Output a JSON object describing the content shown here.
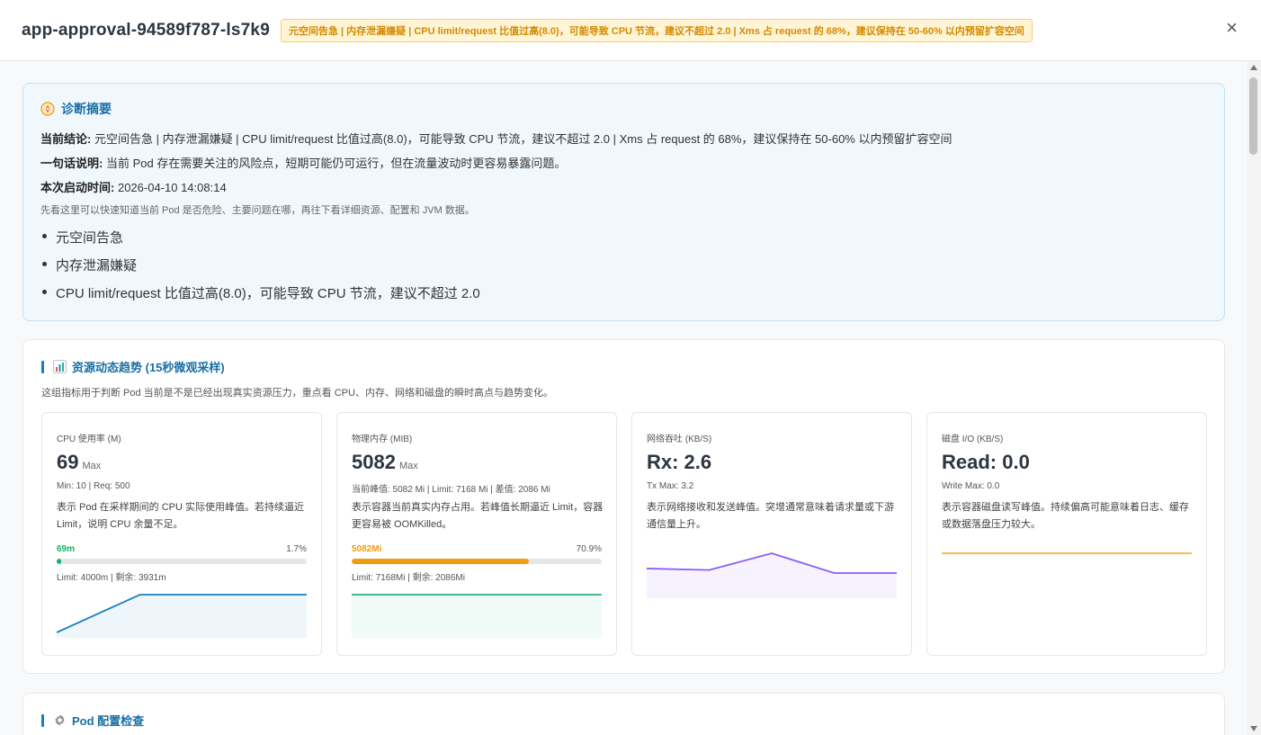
{
  "header": {
    "pod_name": "app-approval-94589f787-ls7k9",
    "alert_badge": "元空间告急 | 内存泄漏嫌疑 | CPU limit/request 比值过高(8.0)，可能导致 CPU 节流，建议不超过 2.0 | Xms 占 request 的 68%，建议保持在 50-60% 以内预留扩容空间",
    "close_label": "×"
  },
  "summary": {
    "title": "诊断摘要",
    "conclusion_label": "当前结论:",
    "conclusion": "元空间告急 | 内存泄漏嫌疑 | CPU limit/request 比值过高(8.0)，可能导致 CPU 节流，建议不超过 2.0 | Xms 占 request 的 68%，建议保持在 50-60% 以内预留扩容空间",
    "explain_label": "一句话说明:",
    "explain": "当前 Pod 存在需要关注的风险点，短期可能仍可运行，但在流量波动时更容易暴露问题。",
    "start_label": "本次启动时间:",
    "start_time": "2026-04-10 14:08:14",
    "hint": "先看这里可以快速知道当前 Pod 是否危险、主要问题在哪，再往下看详细资源、配置和 JVM 数据。",
    "items": [
      "元空间告急",
      "内存泄漏嫌疑",
      "CPU limit/request 比值过高(8.0)，可能导致 CPU 节流，建议不超过 2.0"
    ],
    "icon": "compass-icon"
  },
  "trend": {
    "title": "资源动态趋势 (15秒微观采样)",
    "desc": "这组指标用于判断 Pod 当前是不是已经出现真实资源压力，重点看 CPU、内存、网络和磁盘的瞬时高点与趋势变化。",
    "icon": "bar-chart-icon",
    "cards": [
      {
        "label": "CPU 使用率 (M)",
        "value": "69",
        "unit": "Max",
        "sub": "Min: 10 | Req: 500",
        "desc": "表示 Pod 在采样期间的 CPU 实际使用峰值。若持续逼近 Limit，说明 CPU 余量不足。",
        "progress_current": "69m",
        "progress_pct": "1.7%",
        "progress_fraction": 0.017,
        "progress_meta": "Limit: 4000m | 剩余: 3931m",
        "color": "#17b26a",
        "line_color": "#1a7fc1",
        "series": [
          10,
          69,
          69,
          69
        ]
      },
      {
        "label": "物理内存 (MIB)",
        "value": "5082",
        "unit": "Max",
        "sub": "当前峰值: 5082 Mi | Limit: 7168 Mi | 差值: 2086 Mi",
        "desc": "表示容器当前真实内存占用。若峰值长期逼近 Limit，容器更容易被 OOMKilled。",
        "progress_current": "5082Mi",
        "progress_pct": "70.9%",
        "progress_fraction": 0.709,
        "progress_meta": "Limit: 7168Mi | 剩余: 2086Mi",
        "color": "#f29d10",
        "line_color": "#2fb37c",
        "series": [
          5082,
          5082,
          5082,
          5082
        ]
      },
      {
        "label": "网络吞吐 (KB/S)",
        "value": "Rx: 2.6",
        "unit": "",
        "sub": "Tx Max: 3.2",
        "desc": "表示网络接收和发送峰值。突增通常意味着请求量或下游通信量上升。",
        "line_color": "#8b5cf6",
        "series": [
          1.6,
          1.5,
          2.6,
          1.3,
          1.3
        ]
      },
      {
        "label": "磁盘 I/O (KB/S)",
        "value": "Read: 0.0",
        "unit": "",
        "sub": "Write Max: 0.0",
        "desc": "表示容器磁盘读写峰值。持续偏高可能意味着日志、缓存或数据落盘压力较大。",
        "line_color": "#f2b530",
        "series": [
          0,
          0,
          0,
          0
        ]
      }
    ]
  },
  "pod_config": {
    "title": "Pod 配置检查",
    "icon": "gear-icon"
  }
}
